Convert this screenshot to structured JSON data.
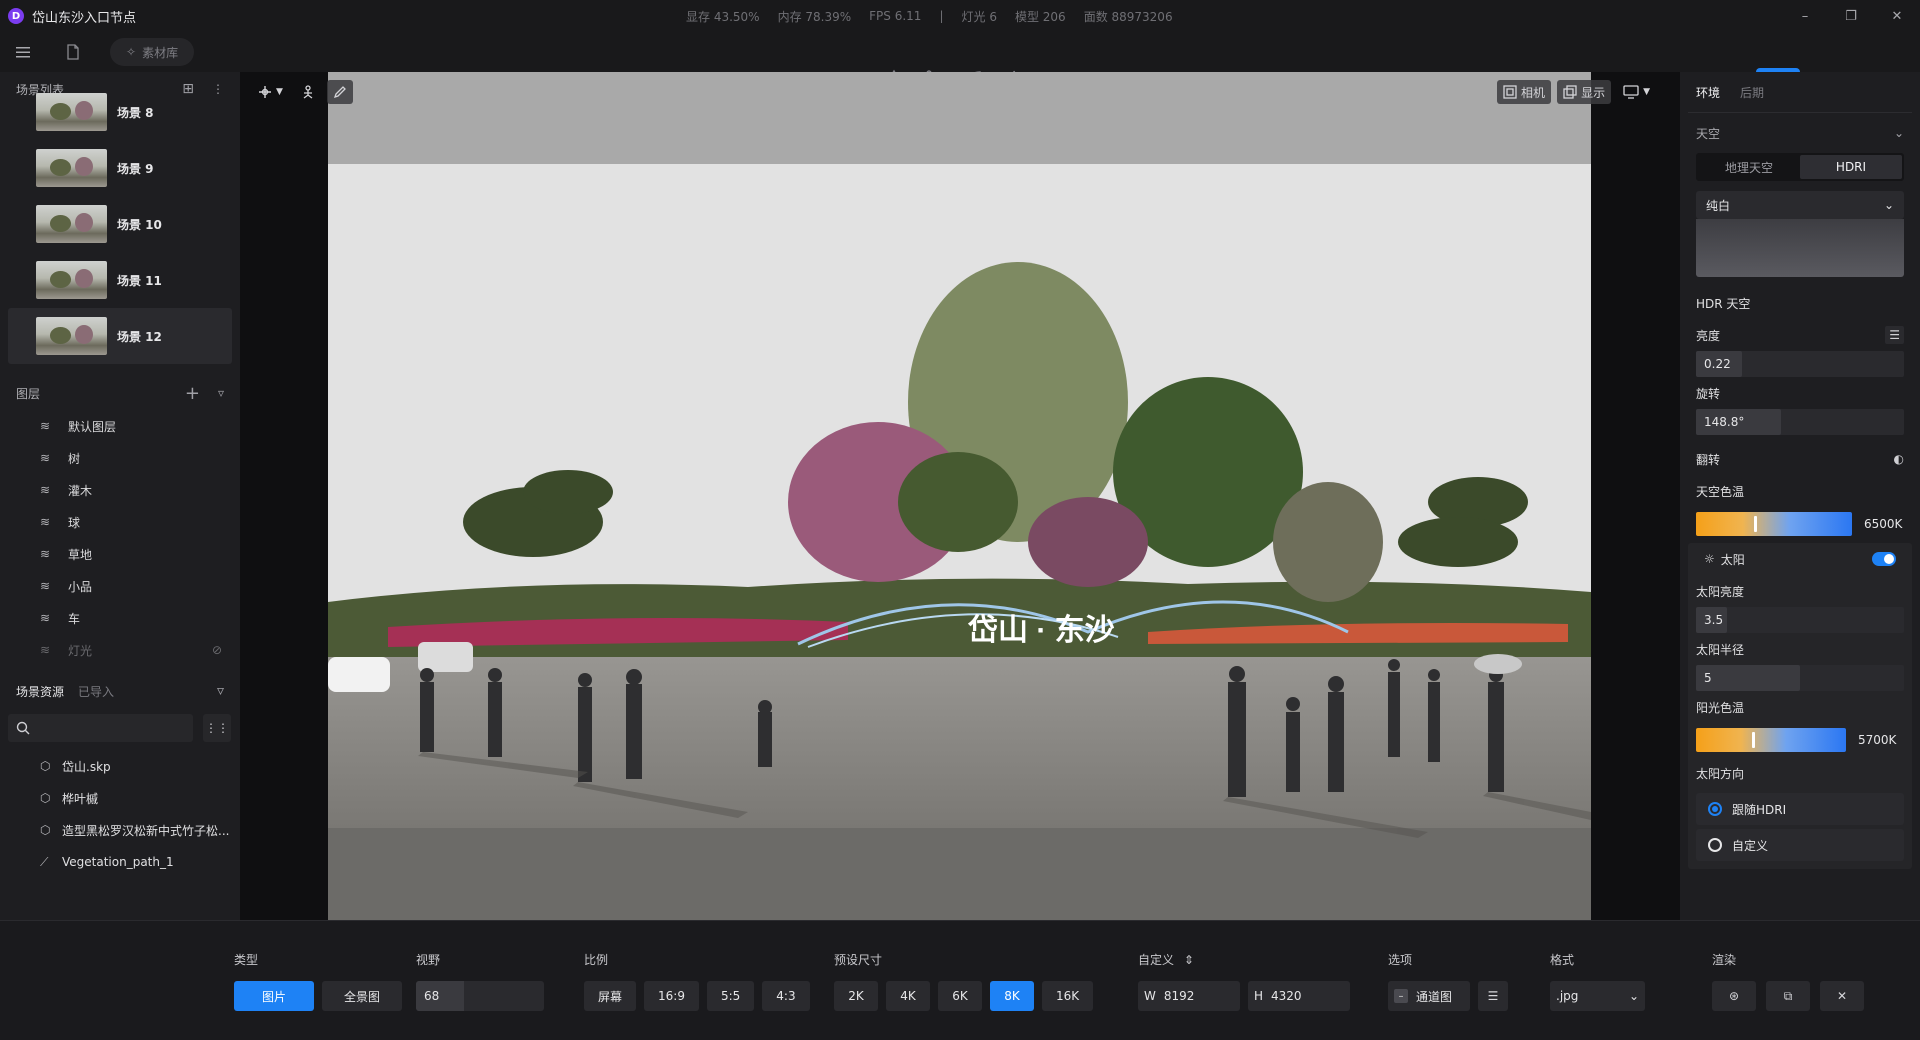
{
  "window": {
    "logo": "D",
    "title": "岱山东沙入口节点",
    "stats": [
      "显存 43.50%",
      "内存 78.39%",
      "FPS 6.11",
      "|",
      "灯光 6",
      "模型 206",
      "面数 88973206"
    ]
  },
  "toolbar": {
    "asset_library": "素材库"
  },
  "scenes": {
    "title": "场景列表",
    "items": [
      {
        "label": "场景 8"
      },
      {
        "label": "场景 9"
      },
      {
        "label": "场景 10"
      },
      {
        "label": "场景 11"
      },
      {
        "label": "场景 12",
        "active": true
      }
    ]
  },
  "layers": {
    "title": "图层",
    "items": [
      "默认图层",
      "树",
      "灌木",
      "球",
      "草地",
      "小品",
      "车",
      "灯光"
    ]
  },
  "resources": {
    "tab_active": "场景资源",
    "tab_inactive": "已导入",
    "items": [
      "岱山.skp",
      "桦叶槭",
      "造型黑松罗汉松新中式竹子松...",
      "Vegetation_path_1"
    ]
  },
  "viewport": {
    "camera_label": "相机",
    "display_label": "显示",
    "signage_text": "岱山 · 东沙"
  },
  "right": {
    "tab_env": "环境",
    "tab_post": "后期",
    "section_sky": "天空",
    "seg_geo": "地理天空",
    "seg_hdri": "HDRI",
    "hdri_preset": "纯白",
    "hdr_sky_label": "HDR 天空",
    "brightness_label": "亮度",
    "brightness_value": "0.22",
    "brightness_fraction": 0.22,
    "rotation_label": "旋转",
    "rotation_value": "148.8°",
    "rotation_fraction": 0.41,
    "flip_label": "翻转",
    "sky_temp_label": "天空色温",
    "sky_temp_value": "6500K",
    "sky_temp_fraction": 0.37,
    "sun_label": "太阳",
    "sun_enabled": true,
    "sun_brightness_label": "太阳亮度",
    "sun_brightness_value": "3.5",
    "sun_brightness_fraction": 0.15,
    "sun_radius_label": "太阳半径",
    "sun_radius_value": "5",
    "sun_radius_fraction": 0.5,
    "sun_temp_label": "阳光色温",
    "sun_temp_value": "5700K",
    "sun_temp_fraction": 0.37,
    "sun_dir_label": "太阳方向",
    "dir_follow": "跟随HDRI",
    "dir_custom": "自定义"
  },
  "bottom": {
    "type_label": "类型",
    "type_image": "图片",
    "type_panorama": "全景图",
    "fov_label": "视野",
    "fov_value": "68",
    "ratio_label": "比例",
    "ratios": [
      "屏幕",
      "16:9",
      "5:5",
      "4:3"
    ],
    "preset_label": "预设尺寸",
    "presets": [
      "2K",
      "4K",
      "6K",
      "8K",
      "16K"
    ],
    "preset_active": "8K",
    "custom_label": "自定义",
    "width_prefix": "W",
    "width_value": "8192",
    "height_prefix": "H",
    "height_value": "4320",
    "options_label": "选项",
    "channel_label": "通道图",
    "format_label": "格式",
    "format_value": ".jpg",
    "render_label": "渲染"
  },
  "colors": {
    "accent": "#1e82f5",
    "panel": "#1e1e21",
    "background": "#141416"
  }
}
